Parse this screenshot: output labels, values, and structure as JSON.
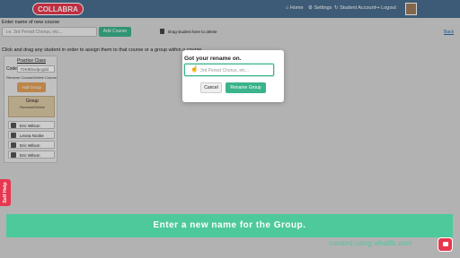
{
  "nav": {
    "logo": "COLLABRA",
    "home": "⌂ Home",
    "settings": "⚙ Settings",
    "student_account": "↻ Student Account",
    "logout": "↪ Logout"
  },
  "page": {
    "new_course_label": "Enter name of new course",
    "course_placeholder": "i.e. 3rd Period Chorus, etc...",
    "add_course": "Add Course",
    "trash_hint": "Drag student here to delete",
    "back": "Back",
    "instructions": "Click and drag any student in order to assign them to that course or a group within a course"
  },
  "class_card": {
    "title": "Practice Class",
    "code_label": "Code:",
    "code_value": "7DK8tbsdpcgdd",
    "rename_delete": "Rename Course/Delete Course",
    "add_group": "Add Group",
    "group_title": "Group",
    "group_sub": "Rename/Delete",
    "students": [
      {
        "name": "Eric Wilson"
      },
      {
        "name": "Leona Nooke"
      },
      {
        "name": "Eric Wilson"
      },
      {
        "name": "Eric Wilson"
      }
    ]
  },
  "modal": {
    "title": "Got your rename on.",
    "placeholder": "3rd Period Chorus, etc...",
    "cancel": "Cancel",
    "rename": "Rename Group"
  },
  "self_help": "Self Help",
  "tooltip": "Enter a new name for the Group.",
  "watermark": "created using whatfix.com",
  "colors": {
    "nav": "#4a6e8e",
    "accent": "#3bb38c",
    "brand": "#e7374f",
    "tooltip": "#4ec99b"
  }
}
